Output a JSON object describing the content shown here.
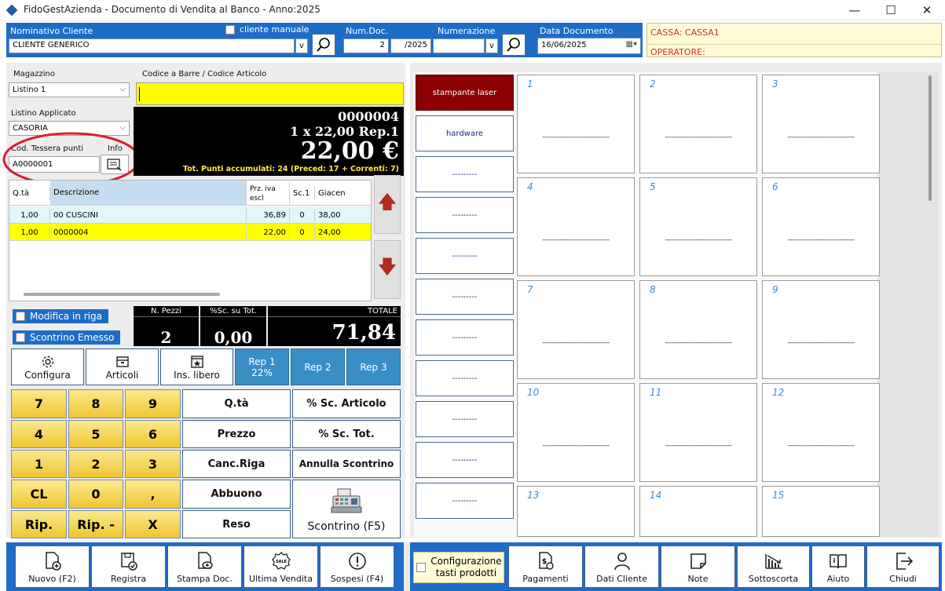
{
  "window": {
    "title": "FidoGestAzienda - Documento di Vendita al Banco - Anno:2025",
    "minimize": "—",
    "maximize": "☐",
    "close": "✕"
  },
  "header": {
    "cliente_label": "Nominativo Cliente",
    "cliente_manuale_label": "cliente manuale",
    "cliente_value": "CLIENTE GENERICO",
    "v_label": "v",
    "numdoc_label": "Num.Doc.",
    "numdoc_value": "2",
    "numdoc_year": "/2025",
    "numerazione_label": "Numerazione",
    "numerazione_value": "",
    "data_label": "Data Documento",
    "data_value": "16/06/2025"
  },
  "cassa": {
    "cassa": "CASSA: CASSA1",
    "operatore": "OPERATORE:"
  },
  "left": {
    "magazzino_label": "Magazzino",
    "magazzino_value": "Listino 1",
    "listino_label": "Listino Applicato",
    "listino_value": "CASORIA",
    "tessera_label": "Cod. Tessera punti",
    "info_label": "Info",
    "tessera_value": "A0000001",
    "barcode_label": "Codice a Barre / Codice Articolo",
    "barcode_value": ""
  },
  "display": {
    "code": "0000004",
    "line": "1 x 22,00 Rep.1",
    "price": "22,00 €",
    "points": "Tot. Punti accumulati: 24  (Preced: 17 + Correnti: 7)"
  },
  "grid": {
    "headers": [
      "Q.tà",
      "Descrizione",
      "Prz. iva escl",
      "Sc.1",
      "Giacen"
    ],
    "rows": [
      [
        "1,00",
        "00 CUSCINI",
        "36,89",
        "0",
        "38,00"
      ],
      [
        "1,00",
        "0000004",
        "22,00",
        "0",
        "24,00"
      ]
    ]
  },
  "options": {
    "modifica_riga": "Modifica in riga",
    "scontrino_emesso": "Scontrino Emesso"
  },
  "totals": {
    "pezzi_label": "N. Pezzi",
    "pezzi_value": "2",
    "sconto_label": "%Sc. su Tot.",
    "sconto_value": "0,00",
    "totale_label": "TOTALE",
    "totale_value": "71,84"
  },
  "functions": {
    "configura": "Configura",
    "articoli": "Articoli",
    "ins_libero": "Ins. libero",
    "rep1": "Rep 1",
    "rep1_iva": "22%",
    "rep2": "Rep 2",
    "rep3": "Rep 3"
  },
  "keypad": {
    "keys": [
      "7",
      "8",
      "9",
      "4",
      "5",
      "6",
      "1",
      "2",
      "3",
      "CL",
      "0",
      ",",
      "Rip.",
      "Rip. -",
      "X"
    ],
    "qta": "Q.tà",
    "prezzo": "Prezzo",
    "canc_riga": "Canc.Riga",
    "abbuono": "Abbuono",
    "reso": "Reso",
    "sc_articolo": "% Sc. Articolo",
    "sc_tot": "% Sc. Tot.",
    "annulla": "Annulla Scontrino",
    "scontrino": "Scontrino (F5)"
  },
  "categories": [
    "stampante laser",
    "hardware",
    "---------",
    "---------",
    "---------",
    "---------",
    "---------",
    "---------",
    "---------",
    "---------",
    "---------"
  ],
  "products": {
    "numbers": [
      "1",
      "2",
      "3",
      "4",
      "5",
      "6",
      "7",
      "8",
      "9",
      "10",
      "11",
      "12",
      "13",
      "14",
      "15"
    ],
    "placeholder": "-------------------------------"
  },
  "bottom": {
    "nuovo": "Nuovo (F2)",
    "registra": "Registra",
    "stampa": "Stampa Doc.",
    "ultima": "Ultima Vendita",
    "sospesi": "Sospesi (F4)",
    "config_tasti": "Configurazione tasti prodotti",
    "pagamenti": "Pagamenti",
    "dati_cliente": "Dati Cliente",
    "note": "Note",
    "sottoscorta": "Sottoscorta",
    "aiuto": "Aiuto",
    "chiudi": "Chiudi"
  },
  "colors": {
    "accent": "#1f6cc7",
    "category_selected": "#8b0000",
    "barcode_bg": "#ffff00",
    "highlight_row": "#ffff00",
    "annotation_circle": "#d9202a"
  }
}
